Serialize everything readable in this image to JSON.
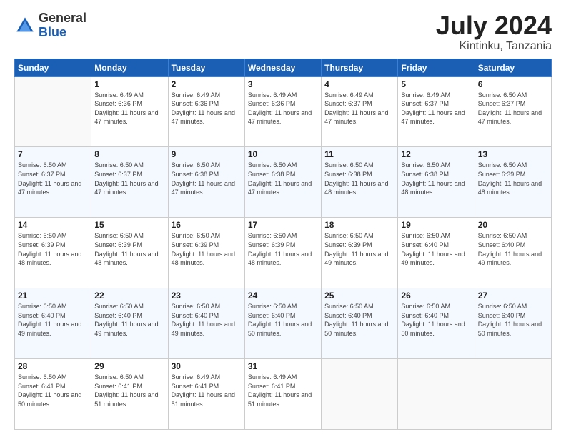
{
  "header": {
    "logo_general": "General",
    "logo_blue": "Blue",
    "title": "July 2024",
    "subtitle": "Kintinku, Tanzania"
  },
  "days_of_week": [
    "Sunday",
    "Monday",
    "Tuesday",
    "Wednesday",
    "Thursday",
    "Friday",
    "Saturday"
  ],
  "weeks": [
    [
      {
        "day": "",
        "info": ""
      },
      {
        "day": "1",
        "info": "Sunrise: 6:49 AM\nSunset: 6:36 PM\nDaylight: 11 hours\nand 47 minutes."
      },
      {
        "day": "2",
        "info": "Sunrise: 6:49 AM\nSunset: 6:36 PM\nDaylight: 11 hours\nand 47 minutes."
      },
      {
        "day": "3",
        "info": "Sunrise: 6:49 AM\nSunset: 6:36 PM\nDaylight: 11 hours\nand 47 minutes."
      },
      {
        "day": "4",
        "info": "Sunrise: 6:49 AM\nSunset: 6:37 PM\nDaylight: 11 hours\nand 47 minutes."
      },
      {
        "day": "5",
        "info": "Sunrise: 6:49 AM\nSunset: 6:37 PM\nDaylight: 11 hours\nand 47 minutes."
      },
      {
        "day": "6",
        "info": "Sunrise: 6:50 AM\nSunset: 6:37 PM\nDaylight: 11 hours\nand 47 minutes."
      }
    ],
    [
      {
        "day": "7",
        "info": "Sunrise: 6:50 AM\nSunset: 6:37 PM\nDaylight: 11 hours\nand 47 minutes."
      },
      {
        "day": "8",
        "info": "Sunrise: 6:50 AM\nSunset: 6:37 PM\nDaylight: 11 hours\nand 47 minutes."
      },
      {
        "day": "9",
        "info": "Sunrise: 6:50 AM\nSunset: 6:38 PM\nDaylight: 11 hours\nand 47 minutes."
      },
      {
        "day": "10",
        "info": "Sunrise: 6:50 AM\nSunset: 6:38 PM\nDaylight: 11 hours\nand 47 minutes."
      },
      {
        "day": "11",
        "info": "Sunrise: 6:50 AM\nSunset: 6:38 PM\nDaylight: 11 hours\nand 48 minutes."
      },
      {
        "day": "12",
        "info": "Sunrise: 6:50 AM\nSunset: 6:38 PM\nDaylight: 11 hours\nand 48 minutes."
      },
      {
        "day": "13",
        "info": "Sunrise: 6:50 AM\nSunset: 6:39 PM\nDaylight: 11 hours\nand 48 minutes."
      }
    ],
    [
      {
        "day": "14",
        "info": "Sunrise: 6:50 AM\nSunset: 6:39 PM\nDaylight: 11 hours\nand 48 minutes."
      },
      {
        "day": "15",
        "info": "Sunrise: 6:50 AM\nSunset: 6:39 PM\nDaylight: 11 hours\nand 48 minutes."
      },
      {
        "day": "16",
        "info": "Sunrise: 6:50 AM\nSunset: 6:39 PM\nDaylight: 11 hours\nand 48 minutes."
      },
      {
        "day": "17",
        "info": "Sunrise: 6:50 AM\nSunset: 6:39 PM\nDaylight: 11 hours\nand 48 minutes."
      },
      {
        "day": "18",
        "info": "Sunrise: 6:50 AM\nSunset: 6:39 PM\nDaylight: 11 hours\nand 49 minutes."
      },
      {
        "day": "19",
        "info": "Sunrise: 6:50 AM\nSunset: 6:40 PM\nDaylight: 11 hours\nand 49 minutes."
      },
      {
        "day": "20",
        "info": "Sunrise: 6:50 AM\nSunset: 6:40 PM\nDaylight: 11 hours\nand 49 minutes."
      }
    ],
    [
      {
        "day": "21",
        "info": "Sunrise: 6:50 AM\nSunset: 6:40 PM\nDaylight: 11 hours\nand 49 minutes."
      },
      {
        "day": "22",
        "info": "Sunrise: 6:50 AM\nSunset: 6:40 PM\nDaylight: 11 hours\nand 49 minutes."
      },
      {
        "day": "23",
        "info": "Sunrise: 6:50 AM\nSunset: 6:40 PM\nDaylight: 11 hours\nand 49 minutes."
      },
      {
        "day": "24",
        "info": "Sunrise: 6:50 AM\nSunset: 6:40 PM\nDaylight: 11 hours\nand 50 minutes."
      },
      {
        "day": "25",
        "info": "Sunrise: 6:50 AM\nSunset: 6:40 PM\nDaylight: 11 hours\nand 50 minutes."
      },
      {
        "day": "26",
        "info": "Sunrise: 6:50 AM\nSunset: 6:40 PM\nDaylight: 11 hours\nand 50 minutes."
      },
      {
        "day": "27",
        "info": "Sunrise: 6:50 AM\nSunset: 6:40 PM\nDaylight: 11 hours\nand 50 minutes."
      }
    ],
    [
      {
        "day": "28",
        "info": "Sunrise: 6:50 AM\nSunset: 6:41 PM\nDaylight: 11 hours\nand 50 minutes."
      },
      {
        "day": "29",
        "info": "Sunrise: 6:50 AM\nSunset: 6:41 PM\nDaylight: 11 hours\nand 51 minutes."
      },
      {
        "day": "30",
        "info": "Sunrise: 6:49 AM\nSunset: 6:41 PM\nDaylight: 11 hours\nand 51 minutes."
      },
      {
        "day": "31",
        "info": "Sunrise: 6:49 AM\nSunset: 6:41 PM\nDaylight: 11 hours\nand 51 minutes."
      },
      {
        "day": "",
        "info": ""
      },
      {
        "day": "",
        "info": ""
      },
      {
        "day": "",
        "info": ""
      }
    ]
  ]
}
